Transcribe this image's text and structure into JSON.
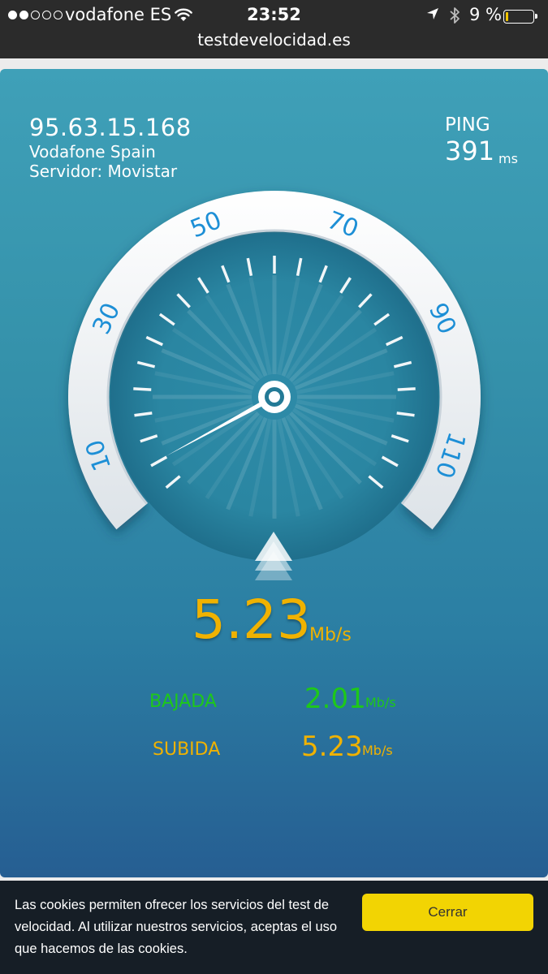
{
  "status_bar": {
    "carrier": "vodafone ES",
    "time": "23:52",
    "battery_text": "9 %",
    "battery_level": 0.09,
    "signal_bars_filled": 2,
    "signal_bars_total": 5,
    "url": "testdevelocidad.es"
  },
  "connection": {
    "ip": "95.63.15.168",
    "isp": "Vodafone Spain",
    "server": "Servidor: Movistar"
  },
  "ping": {
    "label": "PING",
    "value": "391",
    "unit": "ms"
  },
  "gauge": {
    "scale_labels": [
      "10",
      "30",
      "50",
      "70",
      "90",
      "110"
    ],
    "needle_value": 5.23,
    "max_value": 120
  },
  "result": {
    "speed": "5.23",
    "unit": "Mb/s"
  },
  "download": {
    "label": "BAJADA",
    "value": "2.01",
    "unit": "Mb/s"
  },
  "upload": {
    "label": "SUBIDA",
    "value": "5.23",
    "unit": "Mb/s"
  },
  "cookie_bar": {
    "text": "Las cookies permiten ofrecer los servicios del test de velocidad. Al utilizar nuestros servicios, aceptas el uso que hacemos de las cookies.",
    "button": "Cerrar"
  },
  "colors": {
    "speed": "#f0b200",
    "download": "#1ec81a",
    "upload": "#f0b200",
    "scale_text": "#1d8fd6",
    "button": "#f2d403"
  }
}
